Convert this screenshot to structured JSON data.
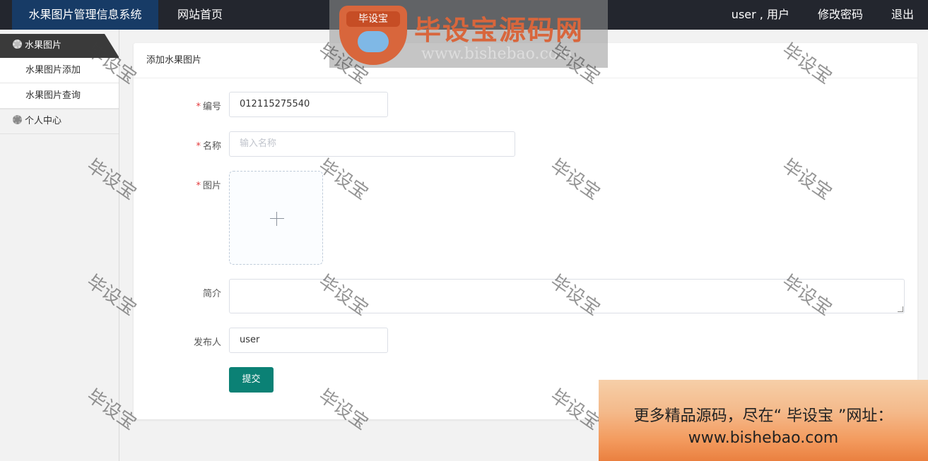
{
  "header": {
    "brand": "水果图片管理信息系统",
    "home": "网站首页",
    "user": "user , 用户",
    "change_password": "修改密码",
    "logout": "退出"
  },
  "sidebar": {
    "groups": [
      {
        "label": "水果图片",
        "items": [
          "水果图片添加",
          "水果图片查询"
        ]
      },
      {
        "label": "个人中心"
      }
    ]
  },
  "form": {
    "card_title": "添加水果图片",
    "required_mark": "*",
    "fields": {
      "code": {
        "label": "编号",
        "value": "012115275540"
      },
      "name": {
        "label": "名称",
        "placeholder": "输入名称"
      },
      "image": {
        "label": "图片",
        "icon": "plus-icon"
      },
      "intro": {
        "label": "简介",
        "value": ""
      },
      "publisher": {
        "label": "发布人",
        "value": "user"
      }
    },
    "submit": "提交"
  },
  "watermark": {
    "logo_badge": "毕设宝",
    "logo_title": "毕设宝源码网",
    "logo_url": "www.bishebao.com",
    "repeat_text": "毕设宝"
  },
  "ad": {
    "line1": "更多精品源码，尽在“ 毕设宝 ”网址：",
    "line2": "www.bishebao.com"
  },
  "colors": {
    "topbar": "#23262e",
    "brand_bg": "#173b66",
    "submit_bg": "#0b8175",
    "required": "#e4393c"
  }
}
